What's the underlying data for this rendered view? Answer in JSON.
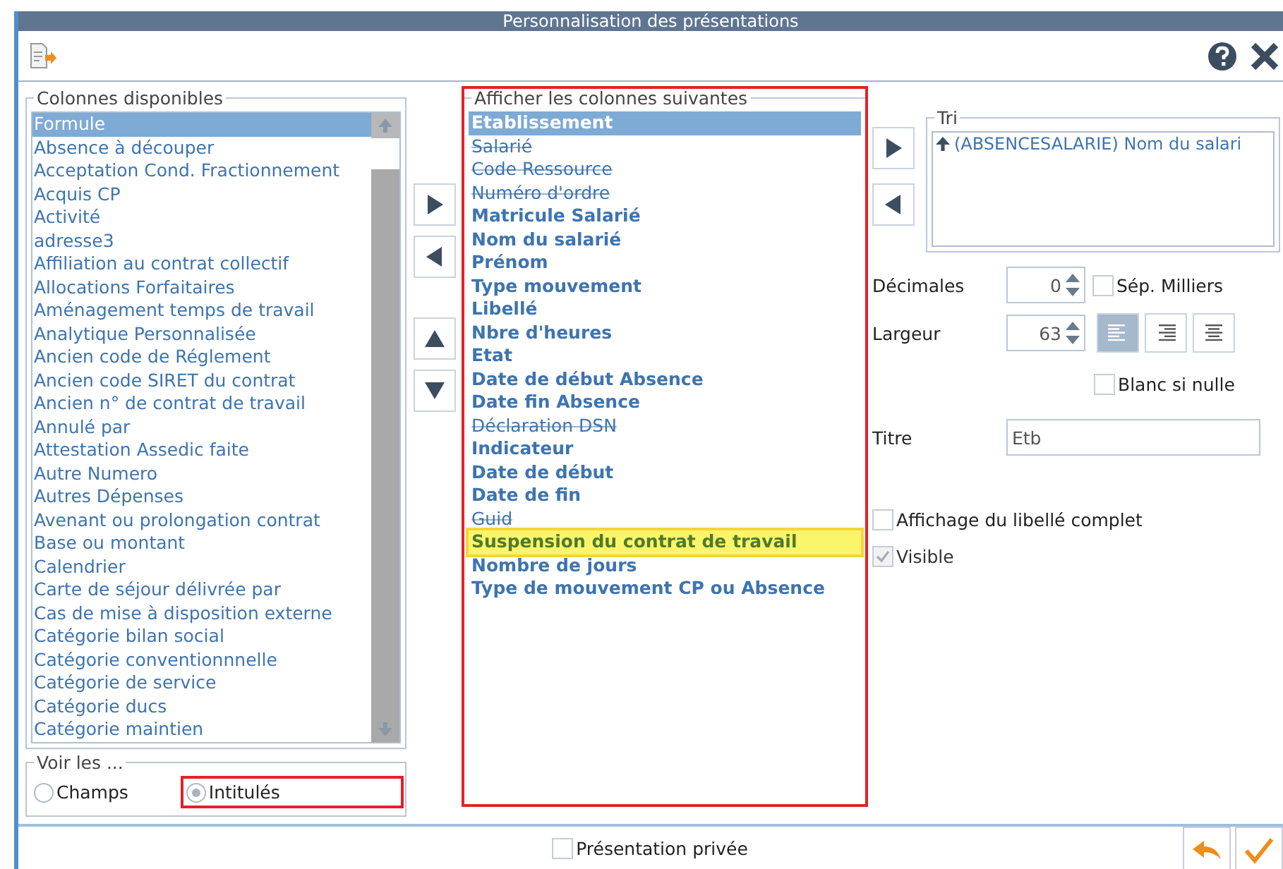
{
  "window": {
    "title": "Personnalisation des présentations"
  },
  "available_columns": {
    "title": "Colonnes disponibles",
    "items": [
      {
        "label": "Formule",
        "selected": true
      },
      {
        "label": "Absence à découper",
        "selected": false
      },
      {
        "label": "Acceptation Cond. Fractionnement",
        "selected": false
      },
      {
        "label": "Acquis CP",
        "selected": false
      },
      {
        "label": "Activité",
        "selected": false
      },
      {
        "label": "adresse3",
        "selected": false
      },
      {
        "label": "Affiliation au contrat collectif",
        "selected": false
      },
      {
        "label": "Allocations Forfaitaires",
        "selected": false
      },
      {
        "label": "Aménagement temps de travail",
        "selected": false
      },
      {
        "label": "Analytique Personnalisée",
        "selected": false
      },
      {
        "label": "Ancien code de Réglement",
        "selected": false
      },
      {
        "label": "Ancien code SIRET du contrat",
        "selected": false
      },
      {
        "label": "Ancien n° de contrat de travail",
        "selected": false
      },
      {
        "label": "Annulé par",
        "selected": false
      },
      {
        "label": "Attestation Assedic faite",
        "selected": false
      },
      {
        "label": "Autre Numero",
        "selected": false
      },
      {
        "label": "Autres Dépenses",
        "selected": false
      },
      {
        "label": "Avenant ou prolongation contrat",
        "selected": false
      },
      {
        "label": "Base ou montant",
        "selected": false
      },
      {
        "label": "Calendrier",
        "selected": false
      },
      {
        "label": "Carte de séjour délivrée par",
        "selected": false
      },
      {
        "label": "Cas de mise à disposition externe",
        "selected": false
      },
      {
        "label": "Catégorie bilan social",
        "selected": false
      },
      {
        "label": "Catégorie conventionnnelle",
        "selected": false
      },
      {
        "label": "Catégorie de service",
        "selected": false
      },
      {
        "label": "Catégorie ducs",
        "selected": false
      },
      {
        "label": "Catégorie maintien",
        "selected": false
      }
    ]
  },
  "view_mode": {
    "title": "Voir les ...",
    "options": [
      {
        "label": "Champs",
        "selected": false,
        "annotated": false
      },
      {
        "label": "Intitulés",
        "selected": true,
        "annotated": true
      }
    ]
  },
  "shown_columns": {
    "title": "Afficher les colonnes suivantes",
    "annotated": true,
    "items": [
      {
        "label": "Etablissement",
        "selected": true,
        "visible": true,
        "highlighted": false
      },
      {
        "label": "Salarié",
        "selected": false,
        "visible": false,
        "highlighted": false
      },
      {
        "label": "Code Ressource",
        "selected": false,
        "visible": false,
        "highlighted": false
      },
      {
        "label": "Numéro d'ordre",
        "selected": false,
        "visible": false,
        "highlighted": false
      },
      {
        "label": "Matricule Salarié",
        "selected": false,
        "visible": true,
        "highlighted": false
      },
      {
        "label": "Nom du salarié",
        "selected": false,
        "visible": true,
        "highlighted": false
      },
      {
        "label": "Prénom",
        "selected": false,
        "visible": true,
        "highlighted": false
      },
      {
        "label": "Type mouvement",
        "selected": false,
        "visible": true,
        "highlighted": false
      },
      {
        "label": "Libellé",
        "selected": false,
        "visible": true,
        "highlighted": false
      },
      {
        "label": "Nbre d'heures",
        "selected": false,
        "visible": true,
        "highlighted": false
      },
      {
        "label": "Etat",
        "selected": false,
        "visible": true,
        "highlighted": false
      },
      {
        "label": "Date de début Absence",
        "selected": false,
        "visible": true,
        "highlighted": false
      },
      {
        "label": "Date fin Absence",
        "selected": false,
        "visible": true,
        "highlighted": false
      },
      {
        "label": "Déclaration DSN",
        "selected": false,
        "visible": false,
        "highlighted": false
      },
      {
        "label": "Indicateur",
        "selected": false,
        "visible": true,
        "highlighted": false
      },
      {
        "label": "Date de début",
        "selected": false,
        "visible": true,
        "highlighted": false
      },
      {
        "label": "Date de fin",
        "selected": false,
        "visible": true,
        "highlighted": false
      },
      {
        "label": "Guid",
        "selected": false,
        "visible": false,
        "highlighted": false
      },
      {
        "label": "Suspension du contrat de travail",
        "selected": false,
        "visible": true,
        "highlighted": true
      },
      {
        "label": "Nombre de jours",
        "selected": false,
        "visible": true,
        "highlighted": false
      },
      {
        "label": "Type de mouvement CP ou Absence",
        "selected": false,
        "visible": true,
        "highlighted": false
      }
    ]
  },
  "sort": {
    "title": "Tri",
    "items": [
      {
        "label": "(ABSENCESALARIE) Nom du salari",
        "selected": false
      }
    ]
  },
  "properties": {
    "decimals": {
      "label": "Décimales",
      "value": "0"
    },
    "thousands_separator": {
      "label": "Sép. Milliers",
      "checked": false
    },
    "width": {
      "label": "Largeur",
      "value": "63"
    },
    "alignment": [
      {
        "kind": "left",
        "selected": true
      },
      {
        "kind": "right",
        "selected": false
      },
      {
        "kind": "center",
        "selected": false
      }
    ],
    "blank_if_zero": {
      "label": "Blanc si nulle",
      "checked": false
    },
    "title": {
      "label": "Titre",
      "value": "Etb"
    },
    "full_label": {
      "label": "Affichage du libellé complet",
      "checked": false,
      "disabled": false
    },
    "visible": {
      "label": "Visible",
      "checked": true,
      "disabled": true
    }
  },
  "footer": {
    "private": {
      "label": "Présentation privée",
      "checked": false
    }
  }
}
